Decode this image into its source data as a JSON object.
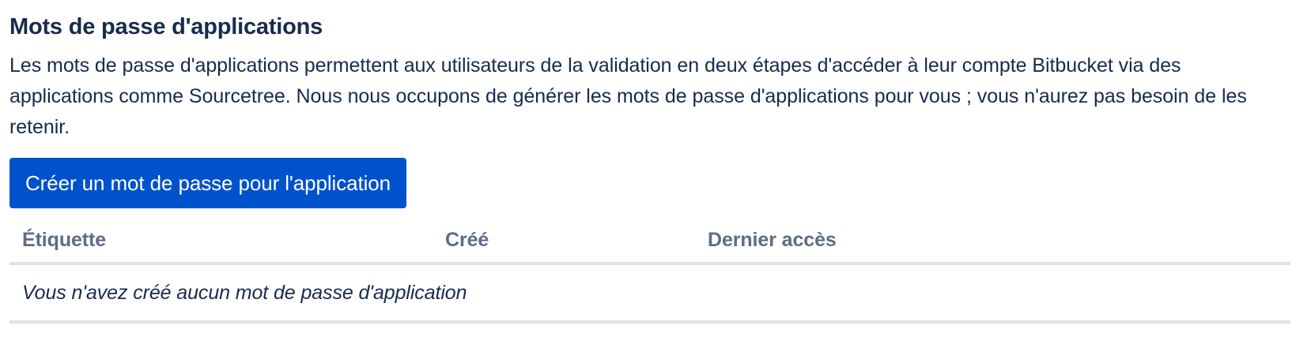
{
  "section": {
    "title": "Mots de passe d'applications",
    "description": "Les mots de passe d'applications permettent aux utilisateurs de la validation en deux étapes d'accéder à leur compte Bitbucket via des applications comme Sourcetree. Nous nous occupons de générer les mots de passe d'applications pour vous ; vous n'aurez pas besoin de les retenir.",
    "create_button_label": "Créer un mot de passe pour l'application"
  },
  "table": {
    "columns": [
      "Étiquette",
      "Créé",
      "Dernier accès"
    ],
    "empty_message": "Vous n'avez créé aucun mot de passe d'application"
  },
  "colors": {
    "primary_button": "#0052cc",
    "text": "#172b4d",
    "table_header_text": "#5e6c84",
    "divider": "#dfe1e6"
  }
}
